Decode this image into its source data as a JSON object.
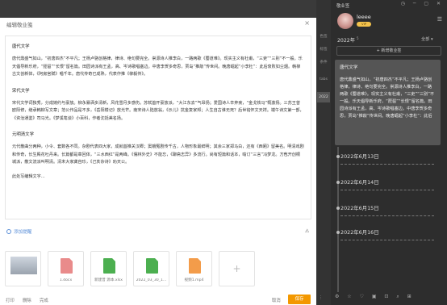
{
  "dialog": {
    "title": "编辑敬业笺",
    "close": "×",
    "editor": {
      "heading1": "唐代文学",
      "para1": "唐代鼎盛气如山，“初唐四杰”不平凡；王杨卢骆创格律，律诗、绝句要完全。崇源诗人推李白，一路两歌《蜀道难》。现实主义有杜甫，“三吏”“三别”不一般。乐天倡导新乐府，“琵琶”“长恨”留名篇。田园诗派有王孟，高、岑诗歌唱塞边。中唐李贺多奇思，贾岛“推敲”传世间。晚唐崛起“小李杜”：此后衰败如尘烟。韩柳古文创新体，《阿房宫赋》唱千年。唐代传奇已成熟，代表作推《柳毅传》。",
      "heading2": "宋代文学",
      "para2": "宋代文学词独秀，分成婉约与豪放。柳永暴洒多清新，风花雪月多感伤。苏轼首开豪放派，“大江东去”气昂扬；爱国诗人辛弃疾，“金戈铁马”慨激扬。三苏王曾欧阳修，继承韩柳写文章；范公作品是不多，《岳阳楼记》放光芒。南宋诗人陆放翁，《示儿》抗金复家邦；人生自古谁无死？后世铭怀文天祥。端午诗文第一部，《资治通鉴》司马光。《梦溪笔谈》小百科，作者沈括美名扬。",
      "heading3": "元明清文学",
      "para3": "元代散曲分两种，小令、套数各不同。杂剧代表四大家，成就首推关汉卿；窦娥冤剧传千古，人物形象最鲜明；其余三家郑马白，还有《西厢》留美名。明清戏剧和传奇，长生殿花吐丹来。长篇都是章回体，“三水西红”是两峰。《儒林外史》不能忘，《聊斋志异》多流行。尚有短篇和话本，喻订“三言”冯梦龙。方苞开创桐城派，散文流派叫明清。清末大家龚自珍，《己亥杂诗》劝天公。",
      "para4": "此处写编辑文字…"
    },
    "reminder": "添加提醒",
    "warn_icon": "⚠",
    "attachments": [
      {
        "name": "",
        "kind": "image"
      },
      {
        "name": "1.docx",
        "kind": "doc",
        "color": "#e98b8b"
      },
      {
        "name": "新建普 源本.xlsx",
        "kind": "xls",
        "color": "#4caf50"
      },
      {
        "name": "2022_03_30_1...",
        "kind": "xls",
        "color": "#4caf50"
      },
      {
        "name": "视频1.mp4",
        "kind": "video",
        "color": "#f39c4a"
      },
      {
        "name": "+",
        "kind": "add"
      }
    ],
    "footer": {
      "print": "打印",
      "delete": "删除",
      "done": "完成",
      "cancel": "取消",
      "save": "保存"
    }
  },
  "strip": {
    "tabs": [
      "色签",
      "标签",
      "条件",
      "tabs",
      "2022"
    ],
    "bottom": "⋮"
  },
  "sidebar": {
    "title": "敬业签",
    "window_controls": "◷ ─ ▢ ✕",
    "user": {
      "name": "leeee",
      "badge": "VIP"
    },
    "menu_icon": "☰",
    "year": "2022年",
    "year_count": "5",
    "filter": "全部 ▾",
    "new_button": "+ 新增敬业签",
    "card": {
      "heading": "唐代文学",
      "text": "唐代鼎盛气如山，“初唐四杰”不平凡；王杨卢骆创格律，律诗、绝句要完全。崇源诗人推李白，一路两歌《蜀道难》。现实主义有杜甫，“三吏”“三别”不一般。乐天倡导新乐府，“琵琶”“长恨”留名篇。田园诗派有王孟，高、岑诗歌唱塞边。中唐李贺多奇思，贾岛“推敲”传世间。晚唐崛起“小李杜”：此后"
    },
    "dates": [
      "2022年6月13日",
      "2022年6月14日",
      "2022年6月15日",
      "2022年6月16日"
    ],
    "bottom_icons": "⚙ ☆ ♡ ▣ ⊡ ⌕ ⊞"
  }
}
